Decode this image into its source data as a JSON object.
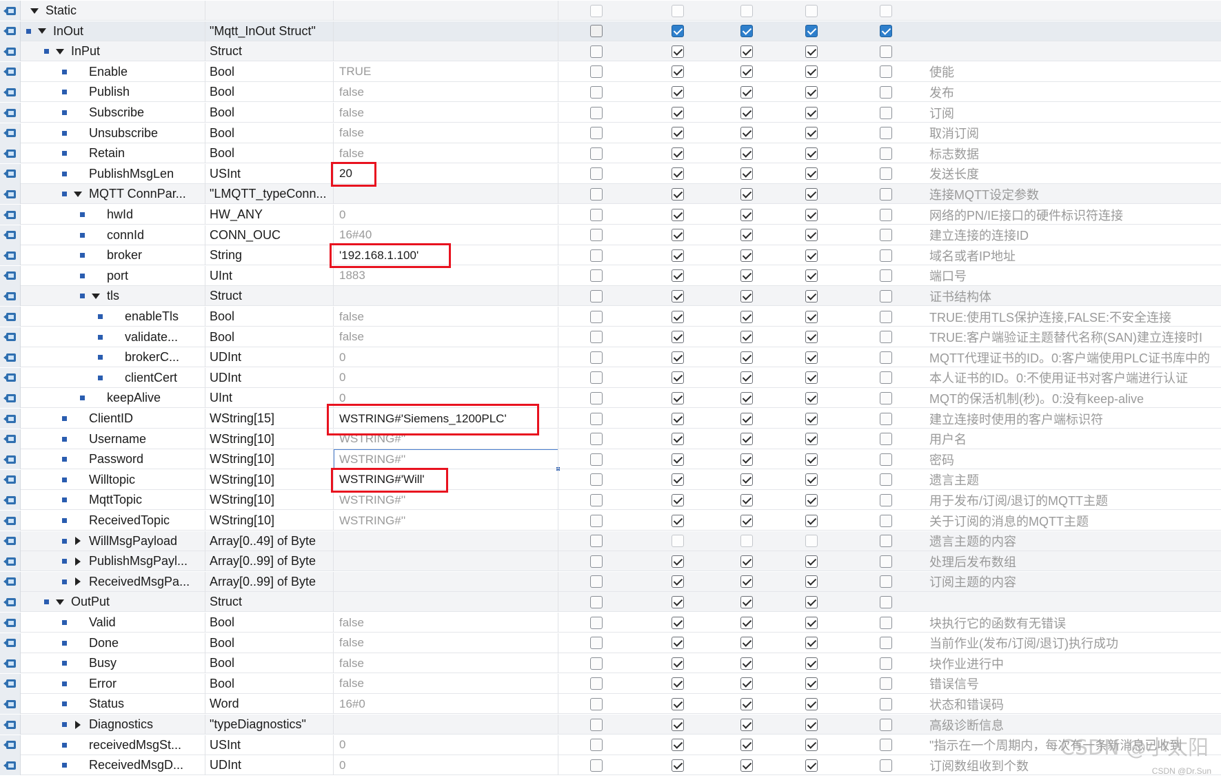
{
  "rows": [
    {
      "name": "Static",
      "type": "",
      "start": "",
      "comment": "",
      "indent": 0,
      "expand": "down",
      "bullet": false
    },
    {
      "name": "InOut",
      "type": "\"Mqtt_InOut Struct\"",
      "start": "",
      "comment": "",
      "indent": 1,
      "expand": "down",
      "bullet": true,
      "highlight": true
    },
    {
      "name": "InPut",
      "type": "Struct",
      "start": "",
      "comment": "",
      "indent": 2,
      "expand": "down",
      "bullet": true
    },
    {
      "name": "Enable",
      "type": "Bool",
      "start": "TRUE",
      "comment": "使能",
      "indent": 3,
      "bullet": true
    },
    {
      "name": "Publish",
      "type": "Bool",
      "start": "false",
      "comment": "发布",
      "indent": 3,
      "bullet": true
    },
    {
      "name": "Subscribe",
      "type": "Bool",
      "start": "false",
      "comment": "订阅",
      "indent": 3,
      "bullet": true
    },
    {
      "name": "Unsubscribe",
      "type": "Bool",
      "start": "false",
      "comment": "取消订阅",
      "indent": 3,
      "bullet": true
    },
    {
      "name": "Retain",
      "type": "Bool",
      "start": "false",
      "comment": "标志数据",
      "indent": 3,
      "bullet": true
    },
    {
      "name": "PublishMsgLen",
      "type": "USInt",
      "start": "20",
      "comment": "发送长度",
      "indent": 3,
      "bullet": true,
      "startDark": true
    },
    {
      "name": "MQTT ConnPar...",
      "type": "\"LMQTT_typeConn...",
      "start": "",
      "comment": "连接MQTT设定参数",
      "indent": 3,
      "expand": "down",
      "bullet": true
    },
    {
      "name": "hwId",
      "type": "HW_ANY",
      "start": "0",
      "comment": "网络的PN/IE接口的硬件标识符连接",
      "indent": 4,
      "bullet": true
    },
    {
      "name": "connId",
      "type": "CONN_OUC",
      "start": "16#40",
      "comment": "建立连接的连接ID",
      "indent": 4,
      "bullet": true
    },
    {
      "name": "broker",
      "type": "String",
      "start": "'192.168.1.100'",
      "comment": "域名或者IP地址",
      "indent": 4,
      "bullet": true,
      "startDark": true
    },
    {
      "name": "port",
      "type": "UInt",
      "start": "1883",
      "comment": "端口号",
      "indent": 4,
      "bullet": true
    },
    {
      "name": "tls",
      "type": "Struct",
      "start": "",
      "comment": "证书结构体",
      "indent": 4,
      "expand": "down",
      "bullet": true
    },
    {
      "name": "enableTls",
      "type": "Bool",
      "start": "false",
      "comment": "TRUE:使用TLS保护连接,FALSE:不安全连接",
      "indent": 5,
      "bullet": true
    },
    {
      "name": "validate...",
      "type": "Bool",
      "start": "false",
      "comment": "TRUE:客户端验证主题替代名称(SAN)建立连接时I",
      "indent": 5,
      "bullet": true
    },
    {
      "name": "brokerC...",
      "type": "UDInt",
      "start": "0",
      "comment": "MQTT代理证书的ID。0:客户端使用PLC证书库中的",
      "indent": 5,
      "bullet": true
    },
    {
      "name": "clientCert",
      "type": "UDInt",
      "start": "0",
      "comment": "本人证书的ID。0:不使用证书对客户端进行认证",
      "indent": 5,
      "bullet": true
    },
    {
      "name": "keepAlive",
      "type": "UInt",
      "start": "0",
      "comment": "MQT的保活机制(秒)。0:没有keep-alive",
      "indent": 4,
      "bullet": true
    },
    {
      "name": "ClientID",
      "type": "WString[15]",
      "start": "WSTRING#'Siemens_1200PLC'",
      "comment": "建立连接时使用的客户端标识符",
      "indent": 3,
      "bullet": true,
      "startDark": true
    },
    {
      "name": "Username",
      "type": "WString[10]",
      "start": "WSTRING#''",
      "comment": "用户名",
      "indent": 3,
      "bullet": true
    },
    {
      "name": "Password",
      "type": "WString[10]",
      "start": "WSTRING#''",
      "comment": "密码",
      "indent": 3,
      "bullet": true,
      "editing": true
    },
    {
      "name": "Willtopic",
      "type": "WString[10]",
      "start": "WSTRING#'Will'",
      "comment": "遗言主题",
      "indent": 3,
      "bullet": true,
      "startDark": true
    },
    {
      "name": "MqttTopic",
      "type": "WString[10]",
      "start": "WSTRING#''",
      "comment": "用于发布/订阅/退订的MQTT主题",
      "indent": 3,
      "bullet": true
    },
    {
      "name": "ReceivedTopic",
      "type": "WString[10]",
      "start": "WSTRING#''",
      "comment": "关于订阅的消息的MQTT主题",
      "indent": 3,
      "bullet": true
    },
    {
      "name": "WillMsgPayload",
      "type": "Array[0..49] of Byte",
      "start": "",
      "comment": "遗言主题的内容",
      "indent": 3,
      "expand": "right",
      "bullet": true
    },
    {
      "name": "PublishMsgPayl...",
      "type": "Array[0..99] of Byte",
      "start": "",
      "comment": "处理后发布数组",
      "indent": 3,
      "expand": "right",
      "bullet": true
    },
    {
      "name": "ReceivedMsgPa...",
      "type": "Array[0..99] of Byte",
      "start": "",
      "comment": "订阅主题的内容",
      "indent": 3,
      "expand": "right",
      "bullet": true
    },
    {
      "name": "OutPut",
      "type": "Struct",
      "start": "",
      "comment": "",
      "indent": 2,
      "expand": "down",
      "bullet": true
    },
    {
      "name": "Valid",
      "type": "Bool",
      "start": "false",
      "comment": "块执行它的函数有无错误",
      "indent": 3,
      "bullet": true
    },
    {
      "name": "Done",
      "type": "Bool",
      "start": "false",
      "comment": "当前作业(发布/订阅/退订)执行成功",
      "indent": 3,
      "bullet": true
    },
    {
      "name": "Busy",
      "type": "Bool",
      "start": "false",
      "comment": "块作业进行中",
      "indent": 3,
      "bullet": true
    },
    {
      "name": "Error",
      "type": "Bool",
      "start": "false",
      "comment": "错误信号",
      "indent": 3,
      "bullet": true
    },
    {
      "name": "Status",
      "type": "Word",
      "start": "16#0",
      "comment": "状态和错误码",
      "indent": 3,
      "bullet": true
    },
    {
      "name": "Diagnostics",
      "type": "\"typeDiagnostics\"",
      "start": "",
      "comment": "高级诊断信息",
      "indent": 3,
      "expand": "right",
      "bullet": true
    },
    {
      "name": "receivedMsgSt...",
      "type": "USInt",
      "start": "0",
      "comment": "\"指示在一个周期内，每次有一条新消息已收到",
      "indent": 3,
      "bullet": true
    },
    {
      "name": "ReceivedMsgD...",
      "type": "UDInt",
      "start": "0",
      "comment": "订阅数组收到个数",
      "indent": 3,
      "bullet": true
    }
  ],
  "watermark": "CSDN @小太阳",
  "watermark_small": "CSDN @Dr.Sun"
}
